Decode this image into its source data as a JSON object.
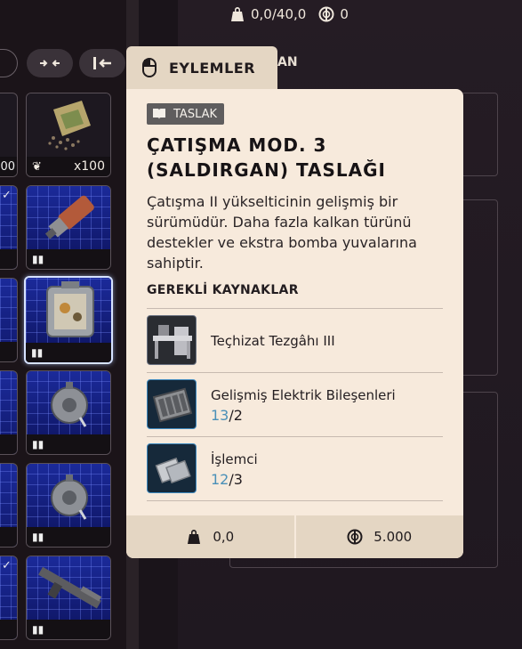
{
  "topbar": {
    "weight": "0,0/40,0",
    "coins": "0"
  },
  "side_label": "AN",
  "inventory": {
    "first_item_qty": "x100",
    "partial_top_text": "00"
  },
  "tooltip": {
    "tab_label": "EYLEMLER",
    "badge": "TASLAK",
    "title": "ÇATIŞMA MOD. 3 (SALDIRGAN) TASLAĞI",
    "description": "Çatışma II yükselticinin gelişmiş bir sürümüdür. Daha fazla kalkan türünü destekler ve ekstra bomba yuvalarına sahiptir.",
    "requirements_heading": "GEREKLİ KAYNAKLAR",
    "requirements": [
      {
        "name": "Teçhizat Tezgâhı III",
        "have": "",
        "need": ""
      },
      {
        "name": "Gelişmiş Elektrik Bileşenleri",
        "have": "13",
        "need": "/2"
      },
      {
        "name": "İşlemci",
        "have": "12",
        "need": "/3"
      }
    ],
    "footer": {
      "weight": "0,0",
      "price": "5.000"
    }
  },
  "colors": {
    "panel_bg": "#f7eadc",
    "tab_bg": "#e4d6c3",
    "have_count": "#4a90b8",
    "blueprint_cell": "#1b2a9a"
  }
}
